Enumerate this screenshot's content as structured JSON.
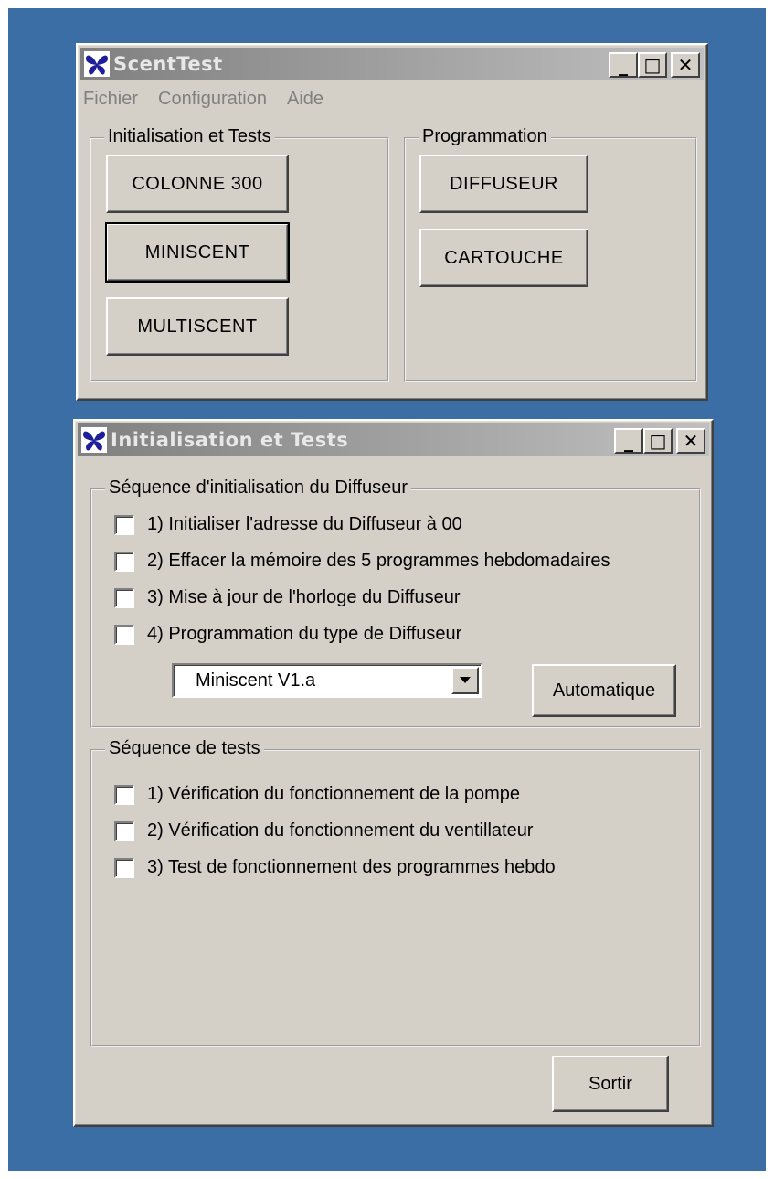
{
  "main_window": {
    "title": "ScentTest",
    "minimize": "_",
    "maximize": "□",
    "close": "✕",
    "menu": [
      "Fichier",
      "Configuration",
      "Aide"
    ],
    "group_init": {
      "label": "Initialisation et Tests",
      "buttons": [
        "COLONNE 300",
        "MINISCENT",
        "MULTISCENT"
      ]
    },
    "group_prog": {
      "label": "Programmation",
      "buttons": [
        "DIFFUSEUR",
        "CARTOUCHE"
      ]
    }
  },
  "tests_window": {
    "title": "Initialisation et Tests",
    "minimize": "_",
    "maximize": "□",
    "close": "✕",
    "init_sequence": {
      "label": "Séquence d'initialisation du Diffuseur",
      "items": [
        "1) Initialiser l'adresse du Diffuseur à 00",
        "2) Effacer la mémoire des 5 programmes hebdomadaires",
        "3) Mise à jour de l'horloge du Diffuseur",
        "4)  Programmation du type de Diffuseur"
      ],
      "type_select": "Miniscent V1.a",
      "auto_button": "Automatique"
    },
    "test_sequence": {
      "label": "Séquence de tests",
      "items": [
        "1) Vérification du fonctionnement de la pompe",
        "2) Vérification du fonctionnement du ventillateur",
        "3) Test de fonctionnement des programmes hebdo"
      ]
    },
    "exit_button": "Sortir"
  },
  "colors": {
    "desktop": "#3a6ea5",
    "window_face": "#d4d0c8",
    "title_inactive_start": "#808080",
    "title_inactive_end": "#c0c0c0"
  },
  "icons": {
    "app": "butterfly-icon",
    "dropdown": "triangle-down-icon"
  }
}
